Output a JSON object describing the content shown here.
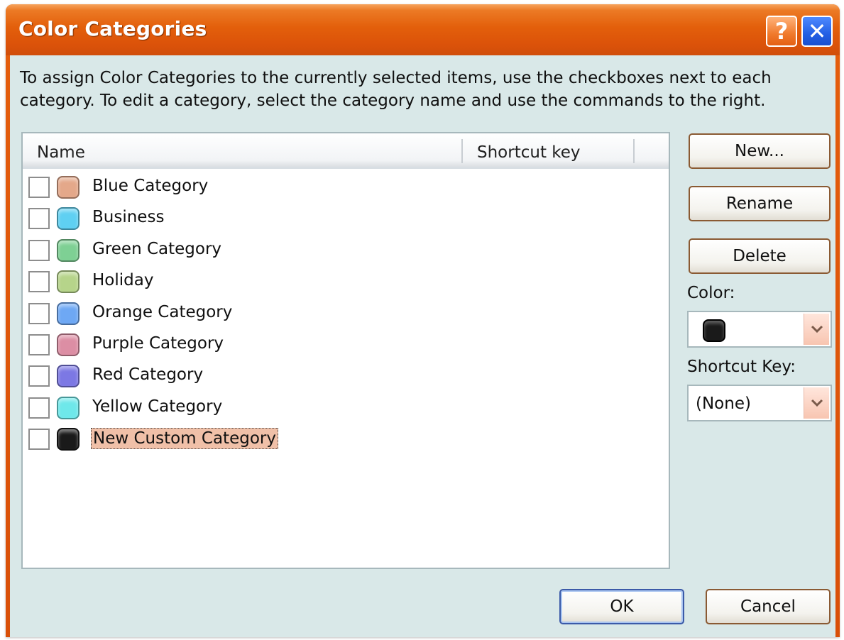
{
  "window": {
    "title": "Color Categories",
    "help_label": "?",
    "close_label": "✕"
  },
  "instructions": "To assign Color Categories to the currently selected items, use the checkboxes next to each category.  To edit a category, select the category name and use the commands to the right.",
  "list": {
    "columns": [
      "Name",
      "Shortcut key"
    ],
    "items": [
      {
        "label": "Blue Category",
        "color": "#e4a88a",
        "checked": false,
        "selected": false
      },
      {
        "label": "Business",
        "color": "#5fd0f2",
        "checked": false,
        "selected": false
      },
      {
        "label": "Green Category",
        "color": "#7ed094",
        "checked": false,
        "selected": false
      },
      {
        "label": "Holiday",
        "color": "#b6d48a",
        "checked": false,
        "selected": false
      },
      {
        "label": "Orange Category",
        "color": "#6ea8f4",
        "checked": false,
        "selected": false
      },
      {
        "label": "Purple Category",
        "color": "#dc8ea4",
        "checked": false,
        "selected": false
      },
      {
        "label": "Red Category",
        "color": "#7c78e4",
        "checked": false,
        "selected": false
      },
      {
        "label": "Yellow Category",
        "color": "#6ee8ea",
        "checked": false,
        "selected": false
      },
      {
        "label": "New Custom Category",
        "color": "#1a1a1a",
        "checked": false,
        "selected": true
      }
    ]
  },
  "buttons": {
    "new": "New...",
    "rename": "Rename",
    "delete": "Delete",
    "ok": "OK",
    "cancel": "Cancel"
  },
  "color_field": {
    "label": "Color:",
    "value_color": "#1a1a1a"
  },
  "shortcut_field": {
    "label": "Shortcut Key:",
    "value": "(None)"
  }
}
